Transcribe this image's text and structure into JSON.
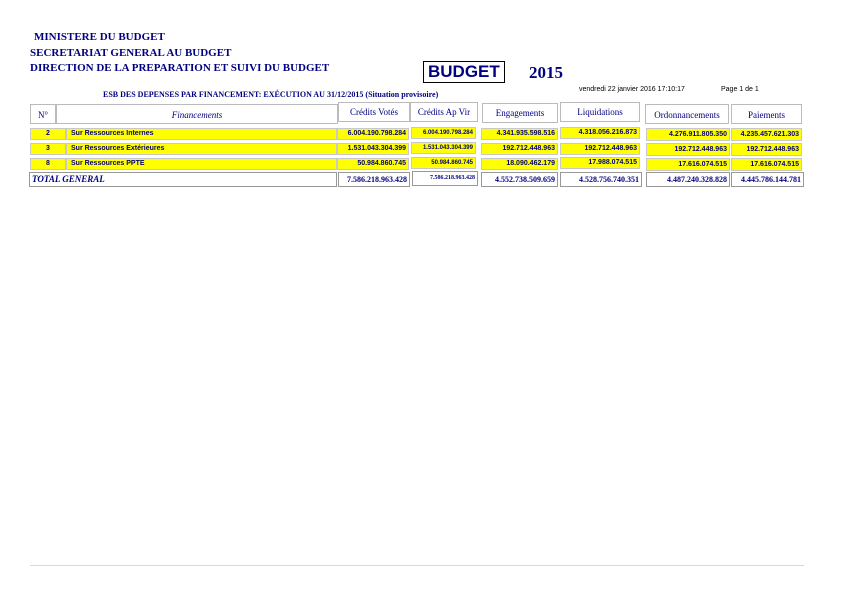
{
  "header": {
    "ministry": "MINISTERE DU BUDGET",
    "secretariat": "SECRETARIAT GENERAL AU BUDGET",
    "direction": "DIRECTION DE LA PREPARATION ET SUIVI DU BUDGET",
    "budget_label": "BUDGET",
    "year": "2015",
    "datetime": "vendredi 22 janvier 2016 17:10:17",
    "page": "Page 1 de 1",
    "subtitle": "ESB DES DEPENSES PAR FINANCEMENT: EXÉCUTION AU 31/12/2015 (Situation provisoire)"
  },
  "table": {
    "columns": {
      "num": "N°",
      "financement": "Financements",
      "credits_votes": "Crédits Votés",
      "credits_ap_vir": "Crédits Ap Vir",
      "engagements": "Engagements",
      "liquidations": "Liquidations",
      "ordonnancements": "Ordonnancements",
      "paiements": "Paiements"
    },
    "rows": [
      {
        "num": "2",
        "label": "Sur Ressources Internes",
        "credits_votes": "6.004.190.798.284",
        "credits_ap_vir": "6.004.190.798.284",
        "engagements": "4.341.935.598.516",
        "liquidations": "4.318.056.216.873",
        "ordonnancements": "4.276.911.805.350",
        "paiements": "4.235.457.621.303"
      },
      {
        "num": "3",
        "label": "Sur Ressources Extérieures",
        "credits_votes": "1.531.043.304.399",
        "credits_ap_vir": "1.531.043.304.399",
        "engagements": "192.712.448.963",
        "liquidations": "192.712.448.963",
        "ordonnancements": "192.712.448.963",
        "paiements": "192.712.448.963"
      },
      {
        "num": "8",
        "label": "Sur Ressources PPTE",
        "credits_votes": "50.984.860.745",
        "credits_ap_vir": "50.984.860.745",
        "engagements": "18.090.462.179",
        "liquidations": "17.988.074.515",
        "ordonnancements": "17.616.074.515",
        "paiements": "17.616.074.515"
      }
    ],
    "total": {
      "label": "TOTAL GENERAL",
      "credits_votes": "7.586.218.963.428",
      "credits_ap_vir": "7.586.218.963.428",
      "engagements": "4.552.738.509.659",
      "liquidations": "4.528.756.740.351",
      "ordonnancements": "4.487.240.328.828",
      "paiements": "4.445.786.144.781"
    }
  }
}
